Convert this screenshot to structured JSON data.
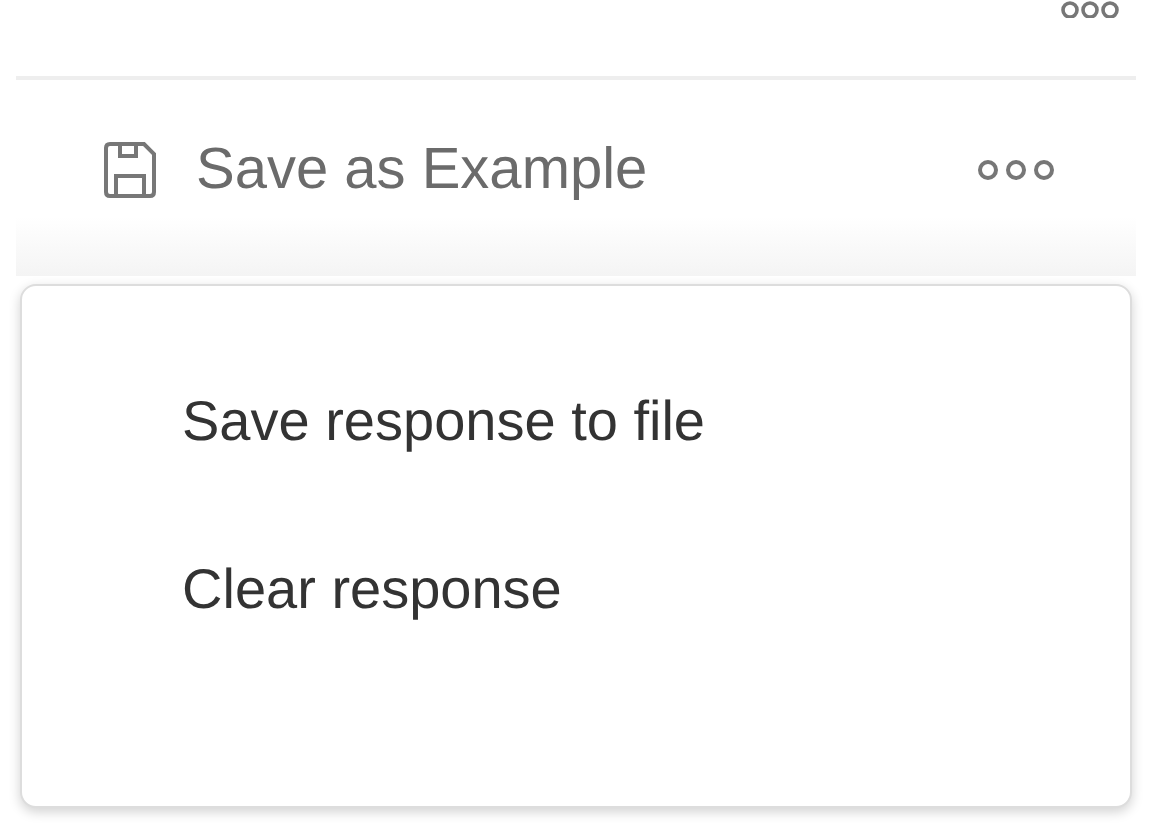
{
  "toolbar": {
    "save_button": {
      "label": "Save as Example"
    }
  },
  "menu": {
    "items": [
      {
        "label": "Save response to file"
      },
      {
        "label": "Clear response"
      }
    ]
  }
}
